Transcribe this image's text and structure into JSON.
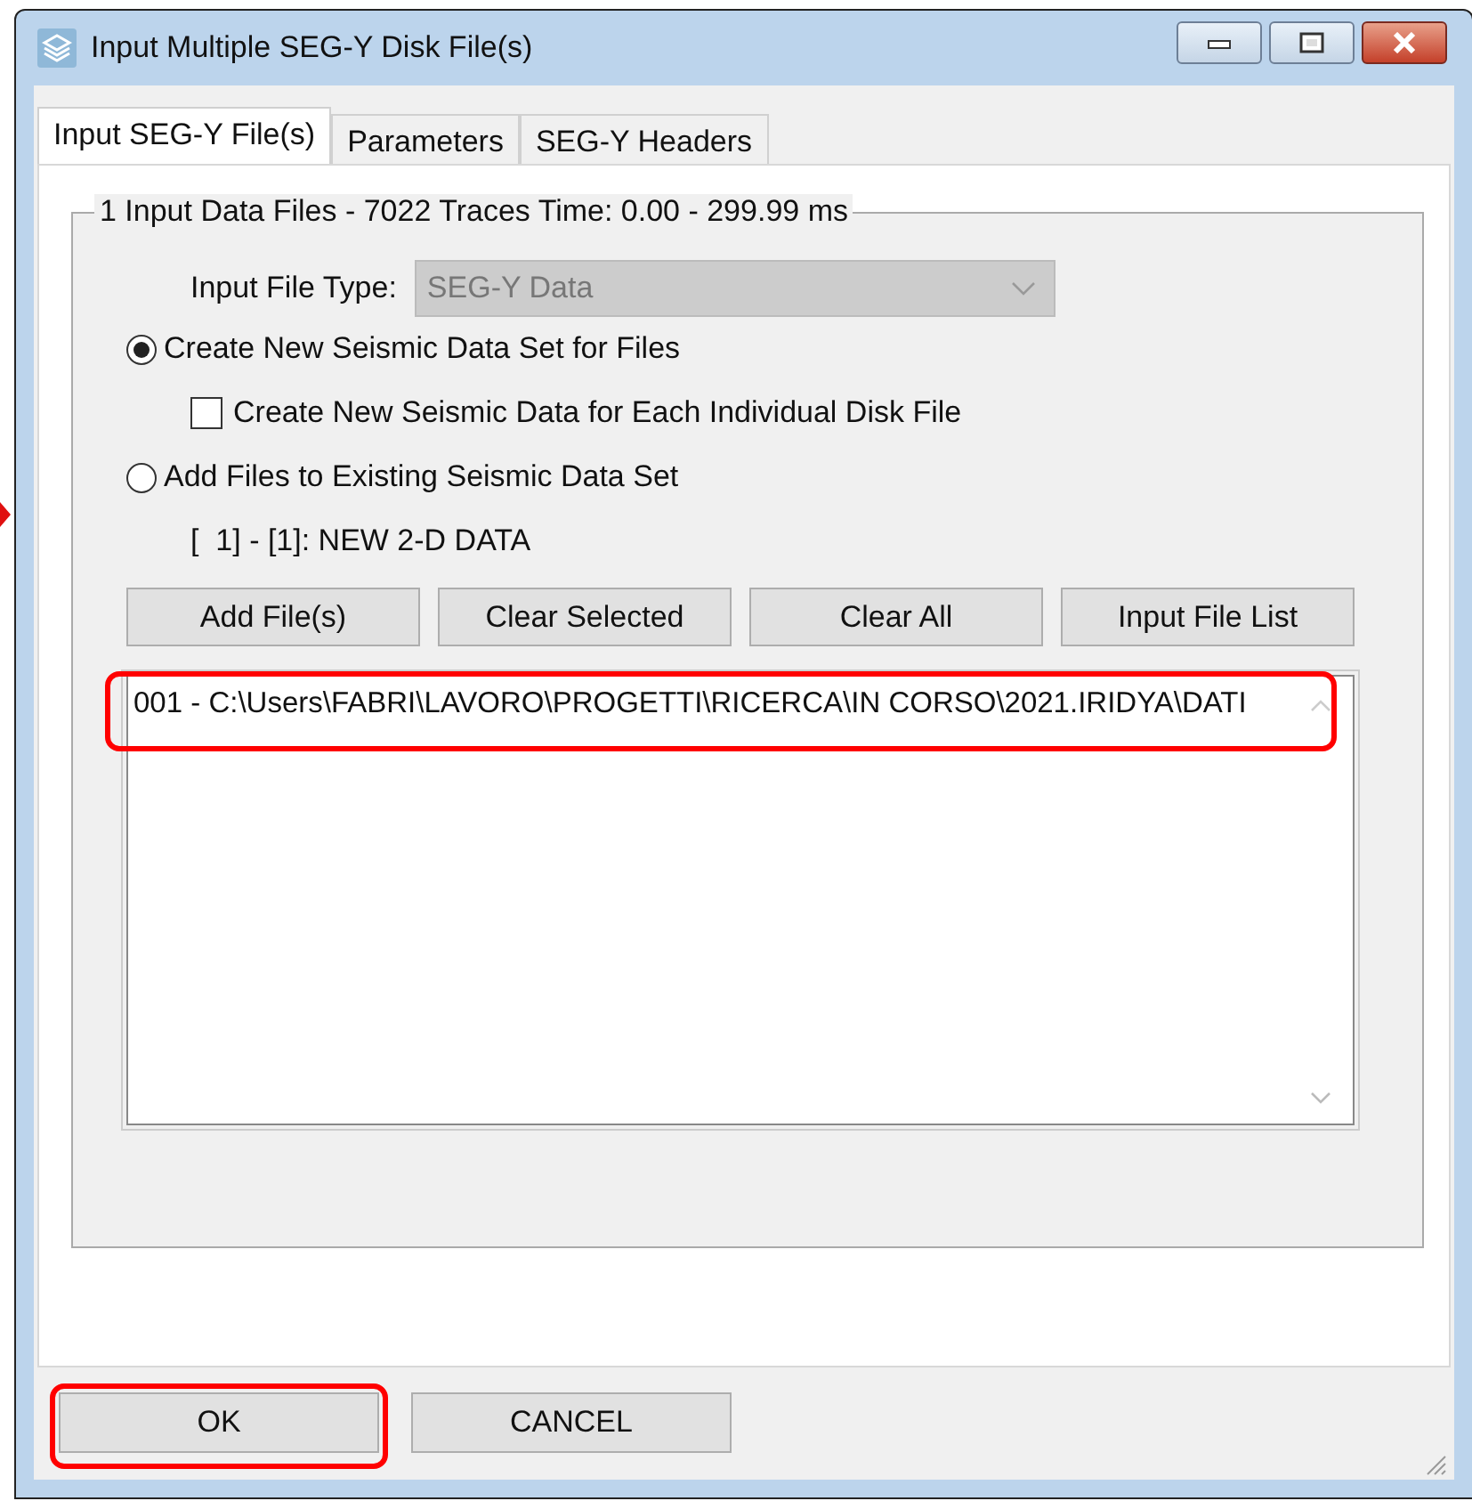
{
  "window": {
    "title": "Input Multiple SEG-Y Disk File(s)"
  },
  "tabs": [
    {
      "label": "Input SEG-Y File(s)",
      "selected": true
    },
    {
      "label": "Parameters",
      "selected": false
    },
    {
      "label": "SEG-Y Headers",
      "selected": false
    }
  ],
  "group": {
    "legend": "1 Input Data Files - 7022 Traces Time: 0.00 - 299.99 ms",
    "file_type": {
      "label": "Input File Type:",
      "value": "SEG-Y Data",
      "disabled": true
    },
    "options": [
      {
        "kind": "radio",
        "label": "Create New Seismic Data Set for Files",
        "selected": true
      },
      {
        "kind": "checkbox",
        "label": "Create New Seismic Data for Each Individual Disk File",
        "checked": false
      },
      {
        "kind": "radio",
        "label": "Add Files to Existing Seismic Data Set",
        "selected": false
      },
      {
        "kind": "text",
        "label": "[  1] - [1]: NEW 2-D DATA"
      }
    ],
    "buttons": [
      "Add File(s)",
      "Clear Selected",
      "Clear All",
      "Input File List"
    ],
    "file_list": {
      "rows": [
        {
          "text": "001 - C:\\Users\\FABRI\\LAVORO\\PROGETTI\\RICERCA\\IN CORSO\\2021.IRIDYA\\DATI",
          "highlighted": true
        }
      ]
    }
  },
  "dialog_buttons": [
    {
      "label": "OK",
      "highlighted": true
    },
    {
      "label": "CANCEL",
      "highlighted": false
    }
  ]
}
